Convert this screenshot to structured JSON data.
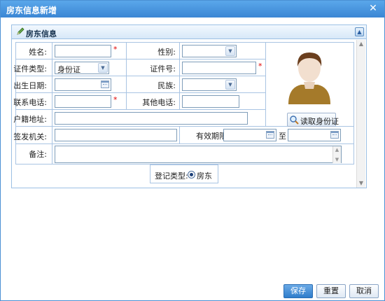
{
  "window": {
    "title": "房东信息新增",
    "close_glyph": "✕"
  },
  "section": {
    "title": "房东信息",
    "collapse_glyph": "▲"
  },
  "form": {
    "name_label": "姓名:",
    "name_value": "",
    "gender_label": "性别:",
    "gender_selected": "",
    "id_type_label": "证件类型:",
    "id_type_selected": "身份证",
    "id_no_label": "证件号:",
    "id_no_value": "",
    "birth_label": "出生日期:",
    "birth_value": "",
    "ethnic_label": "民族:",
    "ethnic_selected": "",
    "phone_label": "联系电话:",
    "phone_value": "",
    "other_phone_label": "其他电话:",
    "other_phone_value": "",
    "household_label": "户籍地址:",
    "household_value": "",
    "issuer_label": "签发机关:",
    "issuer_value": "",
    "valid_label": "有效期限:",
    "valid_from": "",
    "valid_to_label": "至",
    "valid_to": "",
    "remark_label": "备注:",
    "remark_value": "",
    "required_mark": "*",
    "read_id_label": "读取身份证",
    "reg_type_label": "登记类型:",
    "reg_type_option": "房东"
  },
  "footer": {
    "save_label": "保存",
    "reset_label": "重置",
    "cancel_label": "取消"
  },
  "icons": {
    "avatar": "person-avatar-icon",
    "pencil": "pencil-icon",
    "magnifier": "magnifier-icon",
    "calendar": "calendar-icon"
  },
  "colors": {
    "title_bar": "#3b86d4",
    "border": "#a9c4e3",
    "required": "#e00000",
    "avatar_shirt": "#a57a2a",
    "primary_button": "#2f7dcb"
  }
}
